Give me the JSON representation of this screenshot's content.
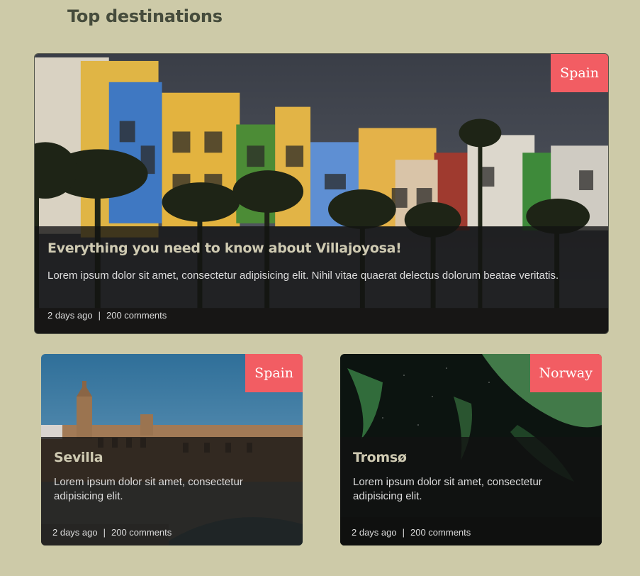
{
  "section": {
    "title": "Top destinations"
  },
  "colors": {
    "background": "#cdcaa8",
    "tag": "#f25d63",
    "title": "#464c3c"
  },
  "cards": [
    {
      "tag": "Spain",
      "title": "Everything you need to know about Villajoyosa!",
      "excerpt": "Lorem ipsum dolor sit amet, consectetur adipisicing elit. Nihil vitae quaerat delectus dolorum beatae veritatis.",
      "time": "2 days ago",
      "separator": "|",
      "comments": "200 comments"
    },
    {
      "tag": "Spain",
      "title": "Sevilla",
      "excerpt": "Lorem ipsum dolor sit amet, consectetur adipisicing elit.",
      "time": "2 days ago",
      "separator": "|",
      "comments": "200 comments"
    },
    {
      "tag": "Norway",
      "title": "Tromsø",
      "excerpt": "Lorem ipsum dolor sit amet, consectetur adipisicing elit.",
      "time": "2 days ago",
      "separator": "|",
      "comments": "200 comments"
    }
  ]
}
